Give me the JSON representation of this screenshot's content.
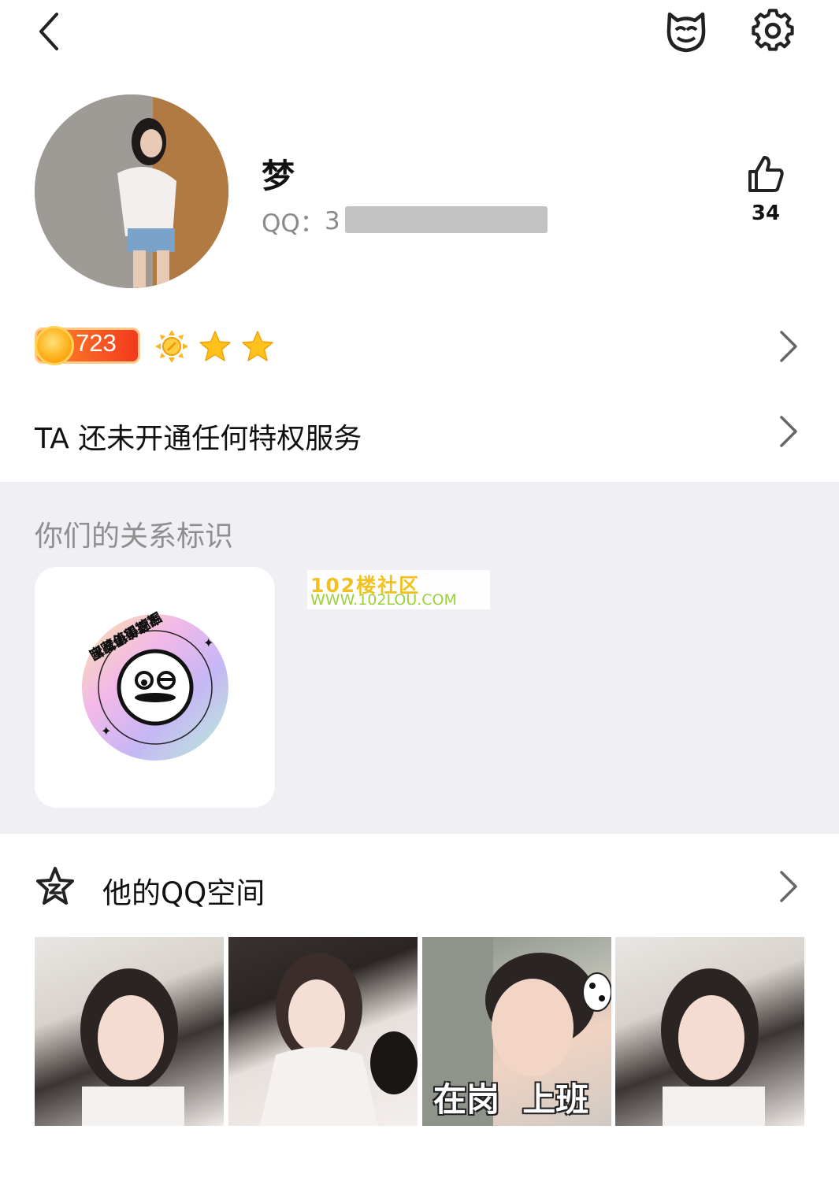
{
  "topbar": {
    "back_icon": "chevron-left-icon",
    "pet_icon": "pet-face-icon",
    "settings_icon": "gear-icon"
  },
  "profile": {
    "nickname": "梦",
    "qq_label": "QQ：",
    "qq_visible_prefix": "3",
    "like_count": "34"
  },
  "level": {
    "value": "723",
    "icons": [
      "sun-icon",
      "star-icon",
      "star-icon"
    ]
  },
  "privilege": {
    "text": "TA 还未开通任何特权服务"
  },
  "relation": {
    "title": "你们的关系标识",
    "badge_text": "宝藏值得挖掘"
  },
  "watermark": {
    "line1": "102楼社区",
    "line2": "WWW.102LOU.COM"
  },
  "qzone": {
    "title": "他的QQ空间",
    "photos": [
      {
        "caption": ""
      },
      {
        "caption": ""
      },
      {
        "caption": "在岗  上班"
      },
      {
        "caption": ""
      }
    ]
  },
  "colors": {
    "accent_orange": "#f23a1d",
    "gray_section": "#efeff4",
    "star": "#ffc21a"
  }
}
